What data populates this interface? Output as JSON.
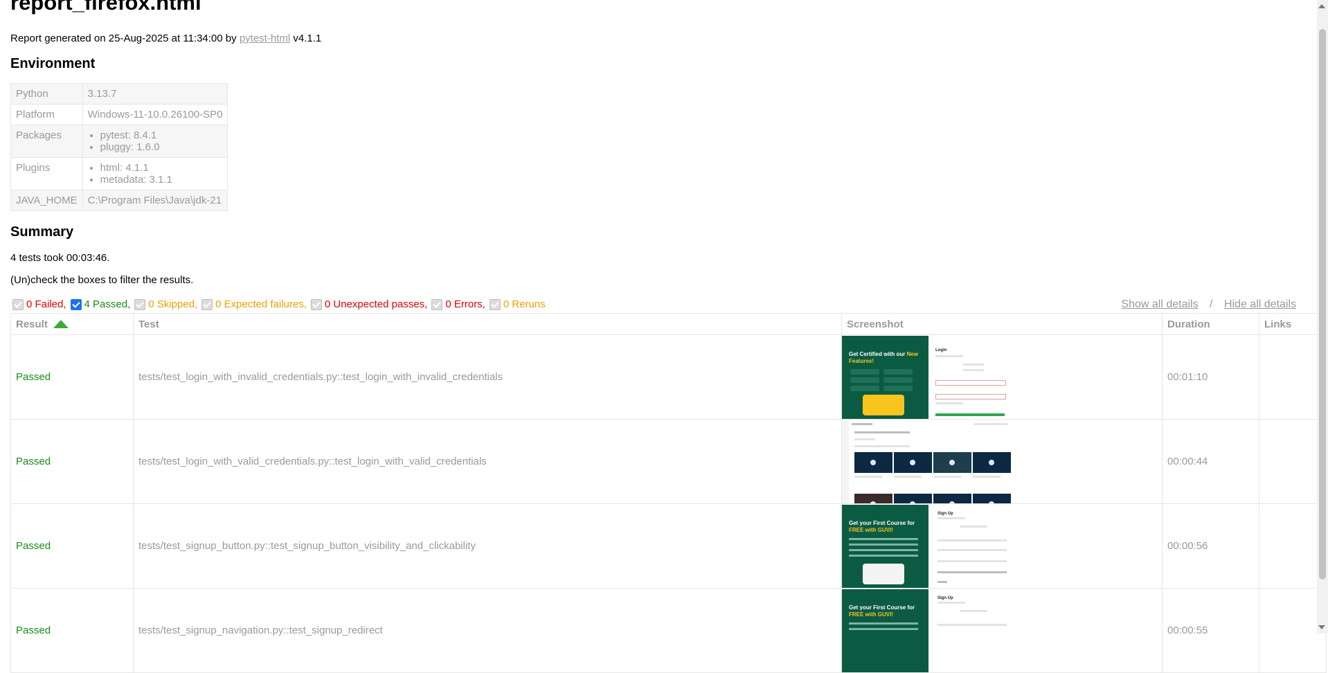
{
  "page": {
    "title": "report_firefox.html",
    "generated_prefix": "Report generated on 25-Aug-2025 at 11:34:00 by",
    "generated_link": "pytest-html",
    "generated_suffix": "v4.1.1"
  },
  "environment": {
    "heading": "Environment",
    "python_label": "Python",
    "python_value": "3.13.7",
    "platform_label": "Platform",
    "platform_value": "Windows-11-10.0.26100-SP0",
    "packages_label": "Packages",
    "packages": [
      "pytest: 8.4.1",
      "pluggy: 1.6.0"
    ],
    "plugins_label": "Plugins",
    "plugins": [
      "html: 4.1.1",
      "metadata: 3.1.1"
    ],
    "java_label": "JAVA_HOME",
    "java_value": "C:\\Program Files\\Java\\jdk-21"
  },
  "summary": {
    "heading": "Summary",
    "took": "4 tests took 00:03:46.",
    "filter_hint": "(Un)check the boxes to filter the results.",
    "filters": {
      "failed": "0 Failed,",
      "passed": "4 Passed,",
      "skipped": "0 Skipped,",
      "xfailed": "0 Expected failures,",
      "xpassed": "0 Unexpected passes,",
      "errors": "0 Errors,",
      "reruns": "0 Reruns"
    },
    "show_all": "Show all details",
    "sep": "/",
    "hide_all": "Hide all details"
  },
  "results": {
    "headers": {
      "result": "Result",
      "test": "Test",
      "screenshot": "Screenshot",
      "duration": "Duration",
      "links": "Links"
    },
    "rows": [
      {
        "result": "Passed",
        "test": "tests/test_login_with_invalid_credentials.py::test_login_with_invalid_credentials",
        "duration": "00:01:10"
      },
      {
        "result": "Passed",
        "test": "tests/test_login_with_valid_credentials.py::test_login_with_valid_credentials",
        "duration": "00:00:44"
      },
      {
        "result": "Passed",
        "test": "tests/test_signup_button.py::test_signup_button_visibility_and_clickability",
        "duration": "00:00:56"
      },
      {
        "result": "Passed",
        "test": "tests/test_signup_navigation.py::test_signup_redirect",
        "duration": "00:00:55"
      }
    ]
  },
  "screenshots": {
    "login_headline_a": "Get Certified with our",
    "login_headline_b": "New Features!",
    "login_form_title": "Login",
    "signup_headline_a": "Get your First Course for",
    "signup_headline_b": "FREE with GUVI!",
    "signup_form_title": "Sign Up"
  }
}
